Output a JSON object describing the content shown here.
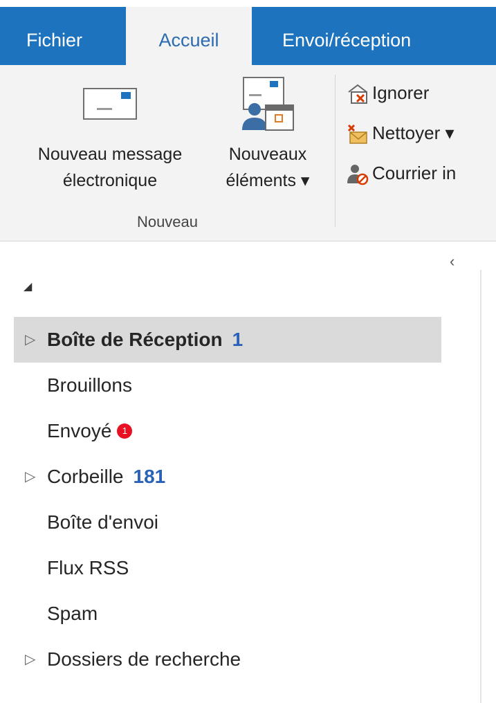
{
  "tabs": [
    {
      "label": "Fichier"
    },
    {
      "label": "Accueil"
    },
    {
      "label": "Envoi/réception"
    }
  ],
  "ribbon": {
    "new_email": {
      "line1": "Nouveau message",
      "line2": "électronique"
    },
    "new_items": {
      "line1": "Nouveaux",
      "line2": "éléments ▾"
    },
    "group_label": "Nouveau",
    "ignore": "Ignorer",
    "cleanup": "Nettoyer ▾",
    "junk": "Courrier in"
  },
  "nav": {
    "collapse_glyph": "‹",
    "account_glyph": "◢",
    "folders": [
      {
        "expand": "▷",
        "name": "Boîte de Réception",
        "count": "1"
      },
      {
        "name": "Brouillons"
      },
      {
        "name": "Envoyé",
        "badge": "1"
      },
      {
        "expand": "▷",
        "name": "Corbeille",
        "count": "181"
      },
      {
        "name": "Boîte d'envoi"
      },
      {
        "name": "Flux RSS"
      },
      {
        "name": "Spam"
      },
      {
        "expand": "▷",
        "name": "Dossiers de recherche"
      }
    ]
  },
  "colors": {
    "accent": "#1e73be",
    "count": "#2a62b8",
    "badge": "#e81123"
  }
}
